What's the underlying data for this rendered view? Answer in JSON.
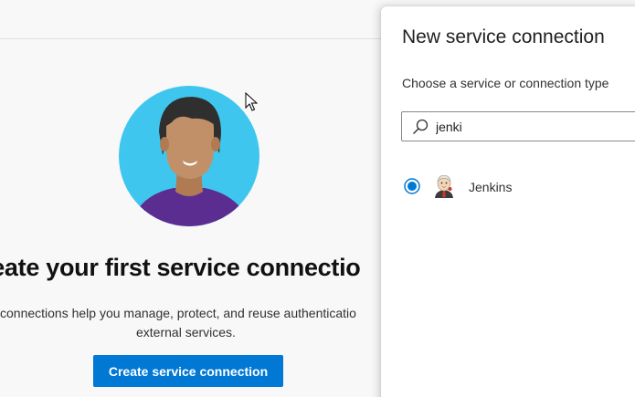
{
  "panel": {
    "title": "New service connection",
    "subtitle": "Choose a service or connection type",
    "search": {
      "value": "jenki",
      "icon": "search-icon"
    },
    "results": [
      {
        "label": "Jenkins",
        "icon": "jenkins-icon",
        "selected": true
      }
    ]
  },
  "empty_state": {
    "title": "reate your first service connectio",
    "description_line1": " connections help you manage, protect, and reuse authenticatio",
    "description_line2": "external services.",
    "cta_label": "Create service connection",
    "illustration": "person-avatar-illustration"
  },
  "colors": {
    "accent": "#0078d4",
    "avatar_bg": "#3fc6ef",
    "avatar_shirt": "#5b2d90"
  }
}
